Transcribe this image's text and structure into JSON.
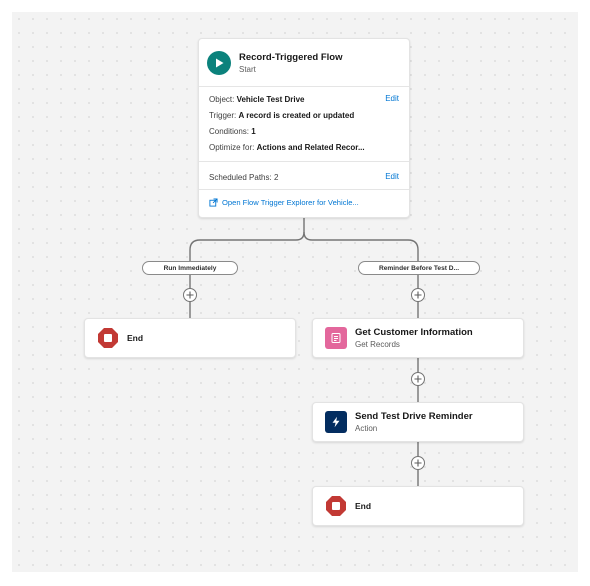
{
  "start": {
    "title": "Record-Triggered Flow",
    "subtitle": "Start",
    "object_label": "Object: ",
    "object_value": "Vehicle Test Drive",
    "trigger_label": "Trigger: ",
    "trigger_value": "A record is created or updated",
    "conditions_label": "Conditions: ",
    "conditions_value": "1",
    "optimize_label": "Optimize for: ",
    "optimize_value": "Actions and Related Recor...",
    "edit_label": "Edit",
    "scheduled_label": "Scheduled Paths: ",
    "scheduled_value": "2",
    "explorer_link": "Open Flow Trigger Explorer for Vehicle..."
  },
  "paths": {
    "left_label": "Run Immediately",
    "right_label": "Reminder Before Test D..."
  },
  "left_branch": {
    "end_label": "End"
  },
  "right_branch": {
    "get_records": {
      "title": "Get Customer Information",
      "subtitle": "Get Records"
    },
    "action": {
      "title": "Send Test Drive Reminder",
      "subtitle": "Action"
    },
    "end_label": "End"
  },
  "colors": {
    "start_icon": "#0b827c",
    "get_records_icon": "#e3679c",
    "action_icon": "#032d60",
    "end_icon": "#c23934",
    "link": "#0176d3"
  },
  "icons": {
    "start": "play-icon",
    "get_records": "records-icon",
    "action": "lightning-bolt-icon",
    "end": "stop-icon",
    "add": "plus-icon",
    "explorer": "external-link-icon"
  }
}
